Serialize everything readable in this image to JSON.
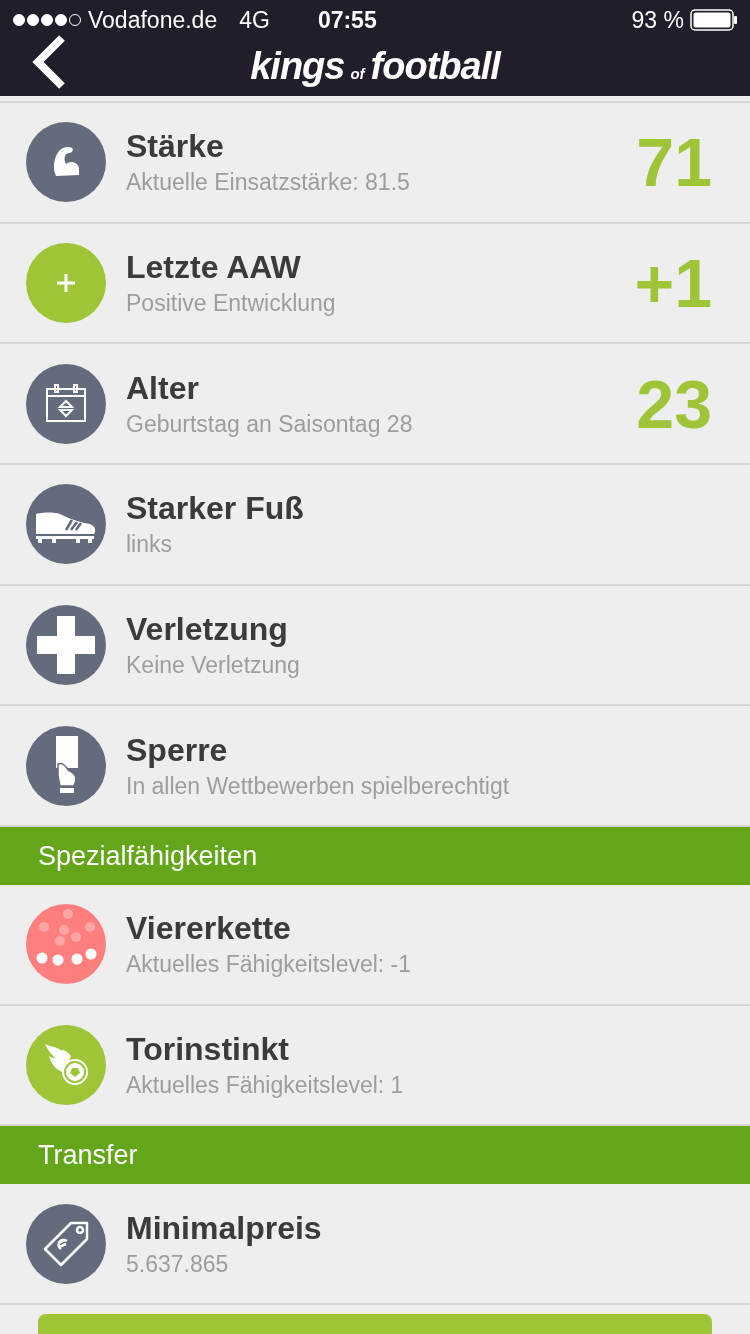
{
  "status_bar": {
    "carrier": "Vodafone.de",
    "network": "4G",
    "time": "07:55",
    "battery": "93 %"
  },
  "nav": {
    "logo": [
      "kings",
      "of",
      "football"
    ]
  },
  "sections": [
    {
      "rows": [
        {
          "kind": "arm",
          "color": "#636b7c",
          "title": "Stärke",
          "subtitle": "Aktuelle Einsatzstärke: 81.5",
          "value": "71"
        },
        {
          "kind": "plus",
          "color": "#9dc537",
          "title": "Letzte AAW",
          "subtitle": "Positive Entwicklung",
          "value": "+1"
        },
        {
          "kind": "calendar",
          "color": "#636b7c",
          "title": "Alter",
          "subtitle": "Geburtstag an Saisontag 28",
          "value": "23"
        },
        {
          "kind": "shoe",
          "color": "#636b7c",
          "title": "Starker Fuß",
          "subtitle": "links"
        },
        {
          "kind": "cross",
          "color": "#636b7c",
          "title": "Verletzung",
          "subtitle": "Keine Verletzung"
        },
        {
          "kind": "card",
          "color": "#636b7c",
          "title": "Sperre",
          "subtitle": "In allen Wettbewerben spielberechtigt"
        }
      ]
    },
    {
      "title": "Spezialfähigkeiten",
      "rows": [
        {
          "kind": "dots",
          "color": "#ff7f7f",
          "title": "Viererkette",
          "subtitle": "Aktuelles Fähigkeitslevel: -1"
        },
        {
          "kind": "fireball",
          "color": "#9dc537",
          "title": "Torinstinkt",
          "subtitle": "Aktuelles Fähigkeitslevel: 1"
        }
      ]
    },
    {
      "title": "Transfer",
      "rows": [
        {
          "kind": "tag",
          "color": "#636b7c",
          "title": "Minimalpreis",
          "subtitle": "5.637.865"
        }
      ]
    }
  ]
}
